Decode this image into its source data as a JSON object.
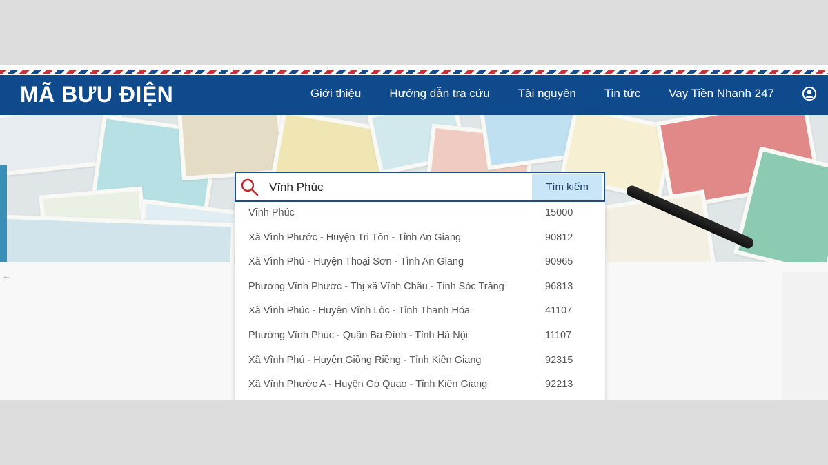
{
  "header": {
    "logo": "MÃ BƯU ĐIỆN",
    "nav": [
      "Giới thiệu",
      "Hướng dẫn tra cứu",
      "Tài nguyên",
      "Tin tức",
      "Vay Tiền Nhanh 247"
    ],
    "user_icon": "user-circle-icon"
  },
  "search": {
    "value": "Vĩnh Phúc",
    "button_label": "Tìm kiếm",
    "icon": "search-icon"
  },
  "results": [
    {
      "address": "Vĩnh Phúc",
      "code": "15000"
    },
    {
      "address": "Xã Vĩnh Phước - Huyện Tri Tôn - Tỉnh An Giang",
      "code": "90812"
    },
    {
      "address": "Xã Vĩnh Phú - Huyện Thoại Sơn - Tỉnh An Giang",
      "code": "90965"
    },
    {
      "address": "Phường Vĩnh Phước - Thị xã Vĩnh Châu - Tỉnh Sóc Trăng",
      "code": "96813"
    },
    {
      "address": "Xã Vĩnh Phúc - Huyện Vĩnh Lộc - Tỉnh Thanh Hóa",
      "code": "41107"
    },
    {
      "address": "Phường Vĩnh Phúc - Quận Ba Đình - Tỉnh Hà Nội",
      "code": "11107"
    },
    {
      "address": "Xã Vĩnh Phú - Huyện Giồng Riềng - Tỉnh Kiên Giang",
      "code": "92315"
    },
    {
      "address": "Xã Vĩnh Phước A - Huyện Gò Quao - Tỉnh Kiên Giang",
      "code": "92213"
    }
  ],
  "colors": {
    "navbar": "#0f4a8c",
    "search_button": "#c8e6f7",
    "search_icon": "#c0272d"
  }
}
